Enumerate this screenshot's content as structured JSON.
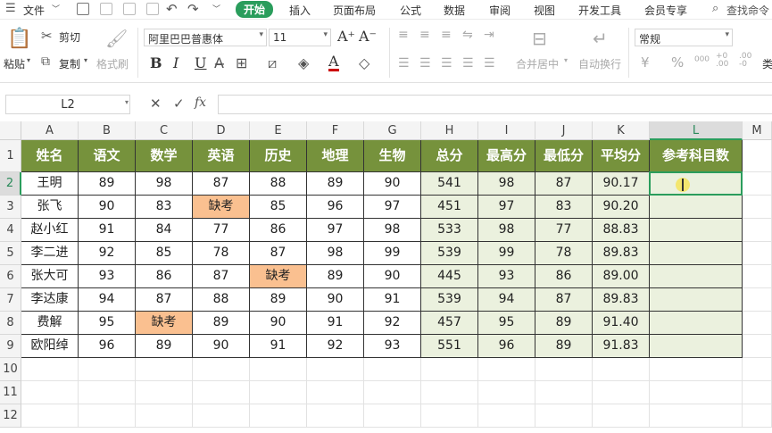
{
  "menu": {
    "file": "文件",
    "tabs": [
      "开始",
      "插入",
      "页面布局",
      "公式",
      "数据",
      "审阅",
      "视图",
      "开发工具",
      "会员专享"
    ],
    "active_tab": "开始",
    "search": "查找命令"
  },
  "ribbon": {
    "paste": "粘贴",
    "cut": "剪切",
    "copy": "复制",
    "format_painter": "格式刷",
    "font_name": "阿里巴巴普惠体",
    "font_size": "11",
    "merge_center": "合并居中",
    "wrap_text": "自动换行",
    "number_format": "常规",
    "type_cut": "类"
  },
  "formula_bar": {
    "name_box": "L2",
    "cancel": "✕",
    "confirm": "✓",
    "fx": "fx",
    "formula": ""
  },
  "columns": [
    "A",
    "B",
    "C",
    "D",
    "E",
    "F",
    "G",
    "H",
    "I",
    "J",
    "K",
    "L",
    "M"
  ],
  "rows": [
    "1",
    "2",
    "3",
    "4",
    "5",
    "6",
    "7",
    "8",
    "9",
    "10",
    "11",
    "12"
  ],
  "headers": [
    "姓名",
    "语文",
    "数学",
    "英语",
    "历史",
    "地理",
    "生物",
    "总分",
    "最高分",
    "最低分",
    "平均分",
    "参考科目数"
  ],
  "data": [
    [
      "王明",
      "89",
      "98",
      "87",
      "88",
      "89",
      "90",
      "541",
      "98",
      "87",
      "90.17",
      ""
    ],
    [
      "张飞",
      "90",
      "83",
      "缺考",
      "85",
      "96",
      "97",
      "451",
      "97",
      "83",
      "90.20",
      ""
    ],
    [
      "赵小红",
      "91",
      "84",
      "77",
      "86",
      "97",
      "98",
      "533",
      "98",
      "77",
      "88.83",
      ""
    ],
    [
      "李二进",
      "92",
      "85",
      "78",
      "87",
      "98",
      "99",
      "539",
      "99",
      "78",
      "89.83",
      ""
    ],
    [
      "张大可",
      "93",
      "86",
      "87",
      "缺考",
      "89",
      "90",
      "445",
      "93",
      "86",
      "89.00",
      ""
    ],
    [
      "李达康",
      "94",
      "87",
      "88",
      "89",
      "90",
      "91",
      "539",
      "94",
      "87",
      "89.83",
      ""
    ],
    [
      "费解",
      "95",
      "缺考",
      "89",
      "90",
      "91",
      "92",
      "457",
      "95",
      "89",
      "91.40",
      ""
    ],
    [
      "欧阳绰",
      "96",
      "89",
      "90",
      "91",
      "92",
      "93",
      "551",
      "96",
      "89",
      "91.83",
      ""
    ]
  ],
  "selected_cell": "L2",
  "colors": {
    "header_fill": "#76923c",
    "absent_fill": "#fac090",
    "calc_fill": "#ebf1de",
    "accent": "#2a9d5c"
  }
}
